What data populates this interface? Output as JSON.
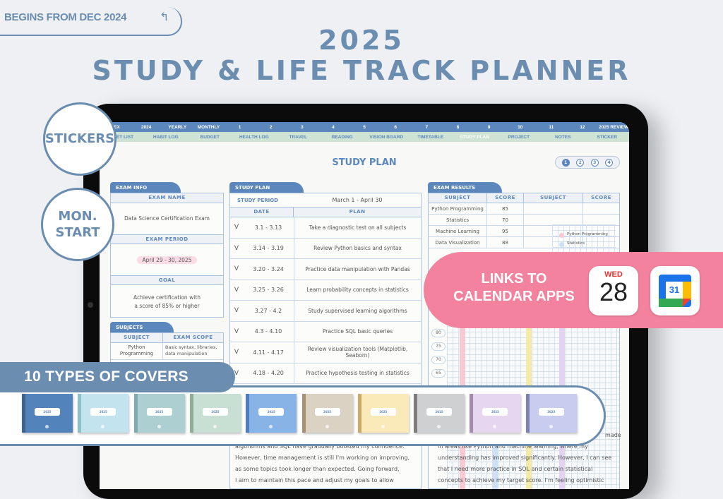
{
  "promo": {
    "begins": "BEGINS FROM DEC 2024",
    "title_year": "2025",
    "title_main": "STUDY & LIFE TRACK PLANNER",
    "badge_stickers": "STICKERS",
    "badge_mon": "MON.",
    "badge_start": "START",
    "calendar_links": [
      "LINKS TO",
      "CALENDAR APPS"
    ],
    "apple_cal_day": "WED",
    "apple_cal_date": "28",
    "google_cal_date": "31",
    "covers_label": "10 TYPES OF COVERS",
    "cover_colors": [
      "#5283bb",
      "#c3e4ef",
      "#aecfd2",
      "#c8dfd3",
      "#88b3e6",
      "#dcd2c4",
      "#fbeab9",
      "#cfd0d2",
      "#e7d6f0",
      "#c8ccee"
    ],
    "cover_spines": [
      "#3c6494",
      "#8fbfc8",
      "#7faaae",
      "#8fae98",
      "#4d7fbf",
      "#a89176",
      "#c9ab67",
      "#7d7d7d",
      "#a48bb0",
      "#7c82b0"
    ],
    "cover_label_text": "2025"
  },
  "nav": {
    "row1": [
      "DEX",
      "2024",
      "YEARLY",
      "MONTHLY",
      "1",
      "2",
      "3",
      "4",
      "5",
      "6",
      "7",
      "8",
      "9",
      "10",
      "11",
      "12",
      "2025 REVIEW"
    ],
    "row2": [
      "CKET LIST",
      "HABIT LOG",
      "BUDGET",
      "HEALTH LOG",
      "TRAVEL",
      "READING",
      "VISION BOARD",
      "TIMETABLE",
      "STUDY PLAN",
      "PROJECT",
      "NOTES",
      "STICKER"
    ],
    "active": "STUDY PLAN"
  },
  "page": {
    "title": "STUDY PLAN",
    "pages": [
      "1",
      "2",
      "3",
      "4"
    ],
    "current_page": "1"
  },
  "exam_info": {
    "tab": "EXAM INFO",
    "name_label": "EXAM NAME",
    "name": "Data Science Certification Exam",
    "period_label": "EXAM PERIOD",
    "period": "April 29 - 30, 2025",
    "goal_label": "GOAL",
    "goal_line1": "Achieve certification with",
    "goal_line2": "a score of 85% or higher"
  },
  "subjects": {
    "tab": "SUBJECTS",
    "col_subject": "SUBJECT",
    "col_scope": "EXAM SCOPE",
    "rows": [
      {
        "subject": "Python Programming",
        "scope": "Basic syntax, libraries, data manipulation"
      }
    ]
  },
  "study_plan": {
    "tab": "STUDY PLAN",
    "period_label": "STUDY PERIOD",
    "period": "March 1 - April 30",
    "col_date": "DATE",
    "col_plan": "PLAN",
    "rows": [
      {
        "check": "V",
        "date": "3.1 - 3.13",
        "plan": "Take a diagnostic test on all subjects"
      },
      {
        "check": "V",
        "date": "3.14 - 3.19",
        "plan": "Review Python basics and syntax"
      },
      {
        "check": "V",
        "date": "3.20 - 3.24",
        "plan": "Practice data manipulation with Pandas"
      },
      {
        "check": "V",
        "date": "3.25 - 3.26",
        "plan": "Learn probability concepts in statistics"
      },
      {
        "check": "V",
        "date": "3.27 - 4.2",
        "plan": "Study supervised learning algorithms"
      },
      {
        "check": "V",
        "date": "4.3 - 4.10",
        "plan": "Practice SQL basic queries"
      },
      {
        "check": "V",
        "date": "4.11 - 4.17",
        "plan": "Review visualization tools (Matplotlib, Seaborn)"
      },
      {
        "check": "V",
        "date": "4.18 - 4.20",
        "plan": "Practice hypothesis testing in statistics"
      }
    ]
  },
  "exam_results": {
    "tab": "EXAM RESULTS",
    "cols": [
      "SUBJECT",
      "SCORE",
      "SUBJECT",
      "SCORE"
    ],
    "rows": [
      {
        "subject": "Python Programming",
        "score": "85"
      },
      {
        "subject": "Statistics",
        "score": "70"
      },
      {
        "subject": "Machine Learning",
        "score": "95"
      },
      {
        "subject": "Data Visualization",
        "score": "88"
      }
    ],
    "legend": [
      "Python Programming",
      "Statistics"
    ],
    "y_ticks": [
      "80",
      "75",
      "70",
      "65"
    ]
  },
  "chart_data": {
    "type": "bar",
    "categories": [
      "Python Programming",
      "Statistics",
      "Machine Learning",
      "Data Visualization"
    ],
    "values": [
      85,
      70,
      95,
      88
    ],
    "colors": [
      "#f6c9d3",
      "#cfe0f5",
      "#f5eaa6",
      "#e2d3f0"
    ],
    "ylim": [
      60,
      100
    ]
  },
  "reflection": {
    "left": [
      "algorithms and SQL have gradually boosted my confidence.",
      "However, time management is still I'm working on improving,",
      "as some topics took longer than expected. Going forward,",
      "I aim to maintain this pace and adjust my goals to allow"
    ],
    "right_fragment": "made",
    "right": [
      "in areas like Python and machine learning, where my",
      "understanding has improved significantly. However, I can see",
      "that I need more practice in SQL and certain statistical",
      "concepts to achieve my target score. I'm feeling optimistic"
    ]
  }
}
